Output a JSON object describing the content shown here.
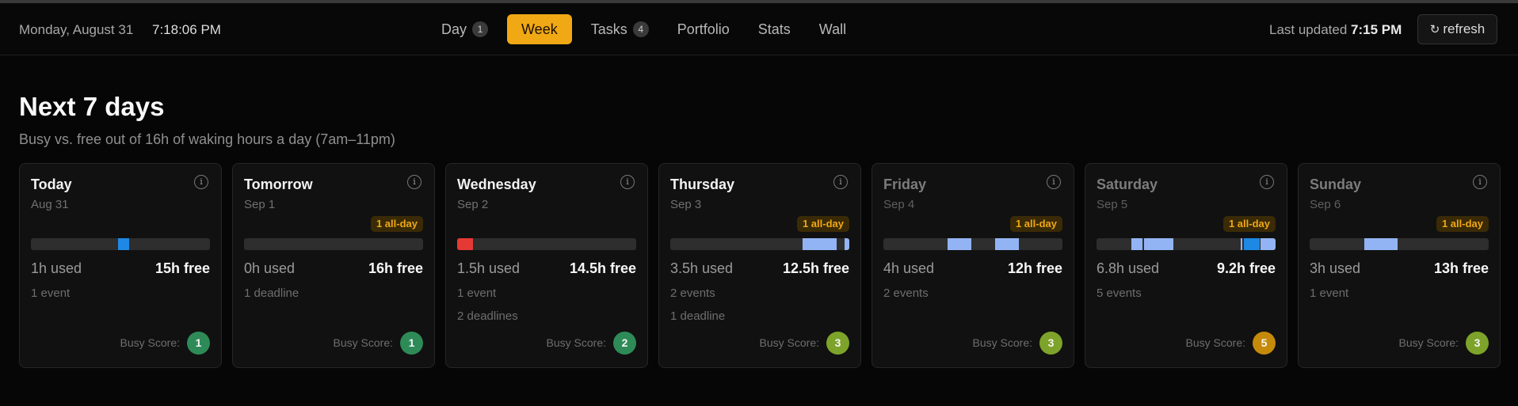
{
  "header": {
    "date": "Monday, August 31",
    "time": "7:18:06 PM",
    "tabs": [
      {
        "label": "Day",
        "badge": "1",
        "active": false
      },
      {
        "label": "Week",
        "badge": null,
        "active": true
      },
      {
        "label": "Tasks",
        "badge": "4",
        "active": false
      },
      {
        "label": "Portfolio",
        "badge": null,
        "active": false
      },
      {
        "label": "Stats",
        "badge": null,
        "active": false
      },
      {
        "label": "Wall",
        "badge": null,
        "active": false
      }
    ],
    "last_updated_label": "Last updated",
    "last_updated_time": "7:15 PM",
    "refresh_icon": "refresh-icon",
    "refresh_label": "refresh"
  },
  "page": {
    "title": "Next 7 days",
    "subtitle": "Busy vs. free out of 16h of waking hours a day (7am–11pm)"
  },
  "colors": {
    "accent": "#f0a814",
    "event": "#93b4f4",
    "current": "#1e88e5",
    "deadline": "#e53935",
    "score_low": "#2e8b57",
    "score_mid": "#7ea32a",
    "score_high": "#c58a0a"
  },
  "busy_score_label": "Busy Score:",
  "days": [
    {
      "day": "Today",
      "date": "Aug 31",
      "allday": null,
      "used": "1h used",
      "free": "15h free",
      "line1": "1 event",
      "line2": "",
      "score": "1",
      "score_color": "#2e8b57",
      "dim": false,
      "segments": [
        {
          "start": 0.485,
          "end": 0.547,
          "color": "#1e88e5"
        }
      ]
    },
    {
      "day": "Tomorrow",
      "date": "Sep 1",
      "allday": "1 all-day",
      "used": "0h used",
      "free": "16h free",
      "line1": "1 deadline",
      "line2": "",
      "score": "1",
      "score_color": "#2e8b57",
      "dim": false,
      "segments": []
    },
    {
      "day": "Wednesday",
      "date": "Sep 2",
      "allday": null,
      "used": "1.5h used",
      "free": "14.5h free",
      "line1": "1 event",
      "line2": "2 deadlines",
      "score": "2",
      "score_color": "#2e8b57",
      "dim": false,
      "segments": [
        {
          "start": 0.0,
          "end": 0.09,
          "color": "#e53935"
        }
      ]
    },
    {
      "day": "Thursday",
      "date": "Sep 3",
      "allday": "1 all-day",
      "used": "3.5h used",
      "free": "12.5h free",
      "line1": "2 events",
      "line2": "1 deadline",
      "score": "3",
      "score_color": "#7ea32a",
      "dim": false,
      "segments": [
        {
          "start": 0.74,
          "end": 0.93,
          "color": "#93b4f4"
        },
        {
          "start": 0.975,
          "end": 1.0,
          "color": "#93b4f4"
        }
      ]
    },
    {
      "day": "Friday",
      "date": "Sep 4",
      "allday": "1 all-day",
      "used": "4h used",
      "free": "12h free",
      "line1": "2 events",
      "line2": "",
      "score": "3",
      "score_color": "#7ea32a",
      "dim": true,
      "segments": [
        {
          "start": 0.36,
          "end": 0.49,
          "color": "#93b4f4"
        },
        {
          "start": 0.625,
          "end": 0.755,
          "color": "#93b4f4"
        }
      ]
    },
    {
      "day": "Saturday",
      "date": "Sep 5",
      "allday": "1 all-day",
      "used": "6.8h used",
      "free": "9.2h free",
      "line1": "5 events",
      "line2": "",
      "score": "5",
      "score_color": "#c58a0a",
      "dim": true,
      "segments": [
        {
          "start": 0.195,
          "end": 0.255,
          "color": "#93b4f4"
        },
        {
          "start": 0.265,
          "end": 0.43,
          "color": "#93b4f4"
        },
        {
          "start": 0.805,
          "end": 0.815,
          "color": "#93b4f4"
        },
        {
          "start": 0.825,
          "end": 0.91,
          "color": "#1e88e5"
        },
        {
          "start": 0.915,
          "end": 1.0,
          "color": "#93b4f4"
        }
      ]
    },
    {
      "day": "Sunday",
      "date": "Sep 6",
      "allday": "1 all-day",
      "used": "3h used",
      "free": "13h free",
      "line1": "1 event",
      "line2": "",
      "score": "3",
      "score_color": "#7ea32a",
      "dim": true,
      "segments": [
        {
          "start": 0.305,
          "end": 0.49,
          "color": "#93b4f4"
        }
      ]
    }
  ]
}
